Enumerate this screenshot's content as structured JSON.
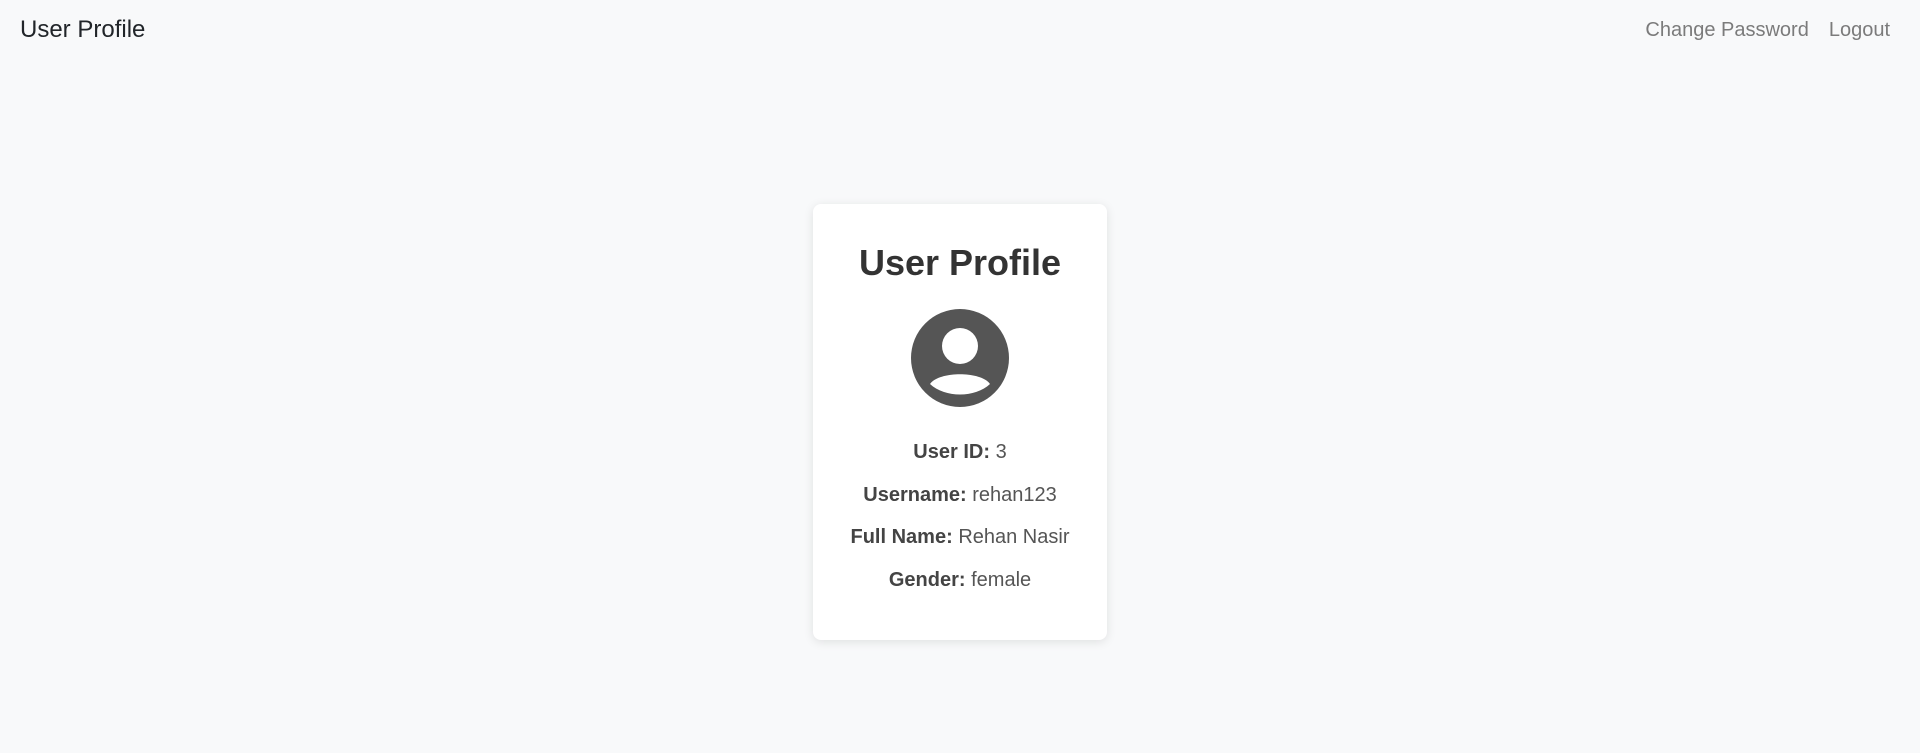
{
  "navbar": {
    "brand": "User Profile",
    "links": [
      {
        "label": "Change Password"
      },
      {
        "label": "Logout"
      }
    ]
  },
  "card": {
    "title": "User Profile",
    "avatar_icon": "user-avatar-icon",
    "fields": [
      {
        "label": "User ID:",
        "value": "3"
      },
      {
        "label": "Username:",
        "value": "rehan123"
      },
      {
        "label": "Full Name:",
        "value": "Rehan Nasir"
      },
      {
        "label": "Gender:",
        "value": "female"
      }
    ]
  },
  "colors": {
    "background": "#f8f9fa",
    "card": "#ffffff",
    "avatar": "#555555",
    "link": "#7b7b7b"
  }
}
